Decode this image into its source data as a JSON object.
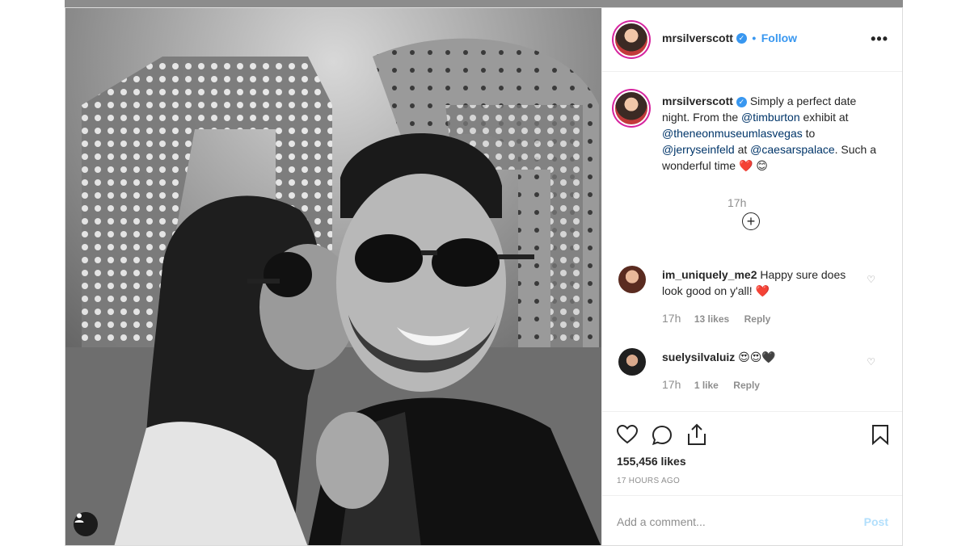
{
  "post": {
    "username": "mrsilverscott",
    "follow_separator": "•",
    "follow_label": "Follow",
    "more_label": "•••",
    "caption_username": "mrsilverscott",
    "caption_parts": {
      "t1": "Simply a perfect date night. From the ",
      "m1": "@timburton",
      "t2": " exhibit at ",
      "m2": "@theneonmuseumlasvegas",
      "t3": " to ",
      "m3": "@jerryseinfeld",
      "t4": " at ",
      "m4": "@caesarspalace",
      "t5": ". Such a wonderful time ",
      "e1": "❤️",
      "e2": "😊"
    },
    "caption_time": "17h"
  },
  "comments": [
    {
      "username": "im_uniquely_me2",
      "text": "Happy sure does look good on y'all!",
      "emoji": "❤️",
      "time": "17h",
      "likes": "13 likes",
      "reply": "Reply"
    },
    {
      "username": "suelysilvaluiz",
      "text": "",
      "emoji": "😍😍🖤",
      "time": "17h",
      "likes": "1 like",
      "reply": "Reply"
    }
  ],
  "actions": {
    "likes": "155,456 likes",
    "posted_ago": "17 HOURS AGO"
  },
  "comment_form": {
    "placeholder": "Add a comment...",
    "post_label": "Post"
  },
  "colors": {
    "accent": "#3897f0",
    "mention": "#003569",
    "muted": "#8e8e8e",
    "heart": "#e0245e",
    "post_disabled": "#b2dffc"
  },
  "icons": [
    "more-icon",
    "verified-badge-icon",
    "heart-icon",
    "comment-icon",
    "share-icon",
    "bookmark-icon",
    "load-more-icon",
    "user-tag-icon"
  ]
}
